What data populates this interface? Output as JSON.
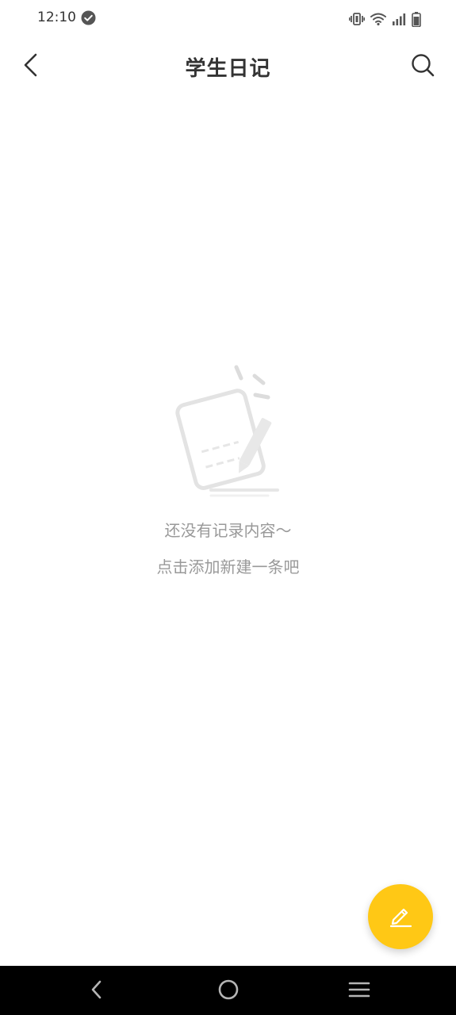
{
  "status_bar": {
    "time": "12:10",
    "icons": [
      "check-circle-icon",
      "vibrate-icon",
      "wifi-icon",
      "signal-icon",
      "battery-icon"
    ]
  },
  "app_bar": {
    "title": "学生日记",
    "back_icon": "chevron-left-icon",
    "search_icon": "search-icon"
  },
  "empty_state": {
    "illustration": "notebook-pencil-icon",
    "line1": "还没有记录内容～",
    "line2": "点击添加新建一条吧"
  },
  "fab": {
    "icon": "edit-pencil-icon",
    "color": "#FFC815"
  },
  "nav_bar": {
    "buttons": [
      "nav-back-icon",
      "nav-home-icon",
      "nav-recents-icon"
    ]
  },
  "colors": {
    "accent": "#FFC815",
    "title_text": "#333333",
    "empty_text": "#999999"
  }
}
